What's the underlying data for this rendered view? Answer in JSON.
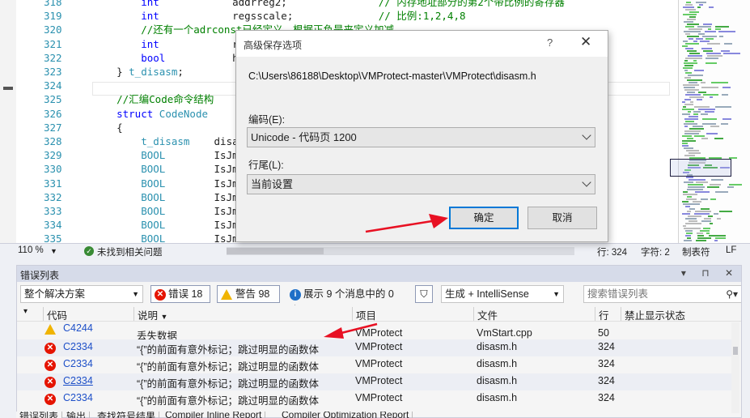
{
  "editor": {
    "lines": [
      {
        "num": "318",
        "parts": [
          [
            "kw",
            "        int            "
          ],
          [
            "tx",
            "addrreg2;               "
          ],
          [
            "cm",
            "// 内存地址部分的第2个带比例的寄存器"
          ]
        ]
      },
      {
        "num": "319",
        "parts": [
          [
            "kw",
            "        int            "
          ],
          [
            "tx",
            "regsscale;              "
          ],
          [
            "cm",
            "// 比例:1,2,4,8"
          ]
        ]
      },
      {
        "num": "320",
        "parts": [
          [
            "cm",
            "        //还有一个adrconst已经定义，根据正负是来定义加减"
          ]
        ]
      },
      {
        "num": "321",
        "parts": [
          [
            "kw",
            "        int            "
          ],
          [
            "tx",
            "r"
          ]
        ]
      },
      {
        "num": "322",
        "parts": [
          [
            "kw",
            "        bool           "
          ],
          [
            "tx",
            "h                                                   h dh)为1"
          ]
        ]
      },
      {
        "num": "323",
        "parts": [
          [
            "tx",
            "    } "
          ],
          [
            "ty",
            "t_disasm"
          ],
          [
            "tx",
            ";"
          ]
        ]
      },
      {
        "num": "324",
        "parts": [
          [
            "tx",
            ""
          ]
        ]
      },
      {
        "num": "325",
        "parts": [
          [
            "cm",
            "    //汇编Code命令结构"
          ]
        ]
      },
      {
        "num": "326",
        "parts": [
          [
            "kw",
            "    struct "
          ],
          [
            "ty",
            "CodeNode"
          ]
        ]
      },
      {
        "num": "327",
        "parts": [
          [
            "tx",
            "    {"
          ]
        ]
      },
      {
        "num": "328",
        "parts": [
          [
            "ty",
            "        t_disasm    "
          ],
          [
            "tx",
            "disa"
          ]
        ]
      },
      {
        "num": "329",
        "parts": [
          [
            "ty",
            "        BOOL        "
          ],
          [
            "tx",
            "IsJm"
          ]
        ]
      },
      {
        "num": "330",
        "parts": [
          [
            "ty",
            "        BOOL        "
          ],
          [
            "tx",
            "IsJm"
          ]
        ]
      },
      {
        "num": "331",
        "parts": [
          [
            "ty",
            "        BOOL        "
          ],
          [
            "tx",
            "IsJm"
          ]
        ]
      },
      {
        "num": "332",
        "parts": [
          [
            "ty",
            "        BOOL        "
          ],
          [
            "tx",
            "IsJm"
          ]
        ]
      },
      {
        "num": "333",
        "parts": [
          [
            "ty",
            "        BOOL        "
          ],
          [
            "tx",
            "IsJm"
          ]
        ]
      },
      {
        "num": "334",
        "parts": [
          [
            "ty",
            "        BOOL        "
          ],
          [
            "tx",
            "IsJm"
          ]
        ]
      },
      {
        "num": "335",
        "parts": [
          [
            "ty",
            "        BOOL        "
          ],
          [
            "tx",
            "IsJm"
          ]
        ]
      }
    ]
  },
  "status_bar": {
    "zoom": "110 %",
    "issues": "未找到相关问题",
    "line": "行: 324",
    "col": "字符: 2",
    "tab": "制表符",
    "eol": "LF"
  },
  "dialog": {
    "title": "高级保存选项",
    "help": "?",
    "close": "✕",
    "path": "C:\\Users\\86188\\Desktop\\VMProtect-master\\VMProtect\\disasm.h",
    "encoding_label": "编码(E):",
    "encoding_value": "Unicode - 代码页 1200",
    "eol_label": "行尾(L):",
    "eol_value": "当前设置",
    "ok": "确定",
    "cancel": "取消"
  },
  "error_list": {
    "title": "错误列表",
    "title_controls": "▾ ⊓ ✕",
    "scope": "整个解决方案",
    "errors_label": "错误 18",
    "warnings_label": "警告 98",
    "messages_label": "展示 9 个消息中的 0 个",
    "build_filter": "生成 + IntelliSense",
    "search_placeholder": "搜索错误列表",
    "columns": {
      "code": "代码",
      "description": "说明",
      "project": "项目",
      "file": "文件",
      "line": "行",
      "suppress": "禁止显示状态"
    },
    "rows": [
      {
        "severity": "warning",
        "code": "C4244",
        "desc": "丢失数据",
        "project": "VMProtect",
        "file": "VmStart.cpp",
        "line": "50",
        "link": false
      },
      {
        "severity": "error",
        "code": "C2334",
        "desc": "“{”的前面有意外标记；跳过明显的函数体",
        "project": "VMProtect",
        "file": "disasm.h",
        "line": "324",
        "link": false
      },
      {
        "severity": "error",
        "code": "C2334",
        "desc": "“{”的前面有意外标记；跳过明显的函数体",
        "project": "VMProtect",
        "file": "disasm.h",
        "line": "324",
        "link": false
      },
      {
        "severity": "error",
        "code": "C2334",
        "desc": "“{”的前面有意外标记；跳过明显的函数体",
        "project": "VMProtect",
        "file": "disasm.h",
        "line": "324",
        "link": true
      },
      {
        "severity": "error",
        "code": "C2334",
        "desc": "“{”的前面有意外标记；跳过明显的函数体",
        "project": "VMProtect",
        "file": "disasm.h",
        "line": "324",
        "link": false
      }
    ]
  },
  "bottom_tabs": [
    "错误列表",
    "输出",
    "查找符号结果",
    "Compiler Inline Report",
    "Compiler Optimization Report"
  ],
  "colors": {
    "keyword": "#0000ff",
    "type": "#2b91af",
    "comment": "#008000",
    "error": "#e51400",
    "warning": "#f0b400",
    "accent": "#0078d7",
    "annotation_arrow": "#e81123"
  }
}
